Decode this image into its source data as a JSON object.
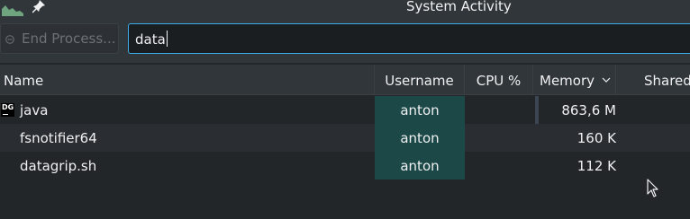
{
  "window": {
    "title": "System Activity"
  },
  "toolbar": {
    "end_process_label": "End Process...",
    "search_value": "data"
  },
  "table": {
    "columns": [
      "Name",
      "Username",
      "CPU %",
      "Memory",
      "Shared"
    ],
    "sorted_column": "Memory",
    "rows": [
      {
        "name": "java",
        "icon": "datagrip-icon",
        "username": "anton",
        "cpu": "",
        "memory": "863,6 M"
      },
      {
        "name": "fsnotifier64",
        "icon": "",
        "username": "anton",
        "cpu": "",
        "memory": "160 K"
      },
      {
        "name": "datagrip.sh",
        "icon": "",
        "username": "anton",
        "cpu": "",
        "memory": "112 K"
      }
    ]
  },
  "colors": {
    "background": "#232629",
    "username_highlight": "#1d4848",
    "focus_border": "#3daee9"
  }
}
